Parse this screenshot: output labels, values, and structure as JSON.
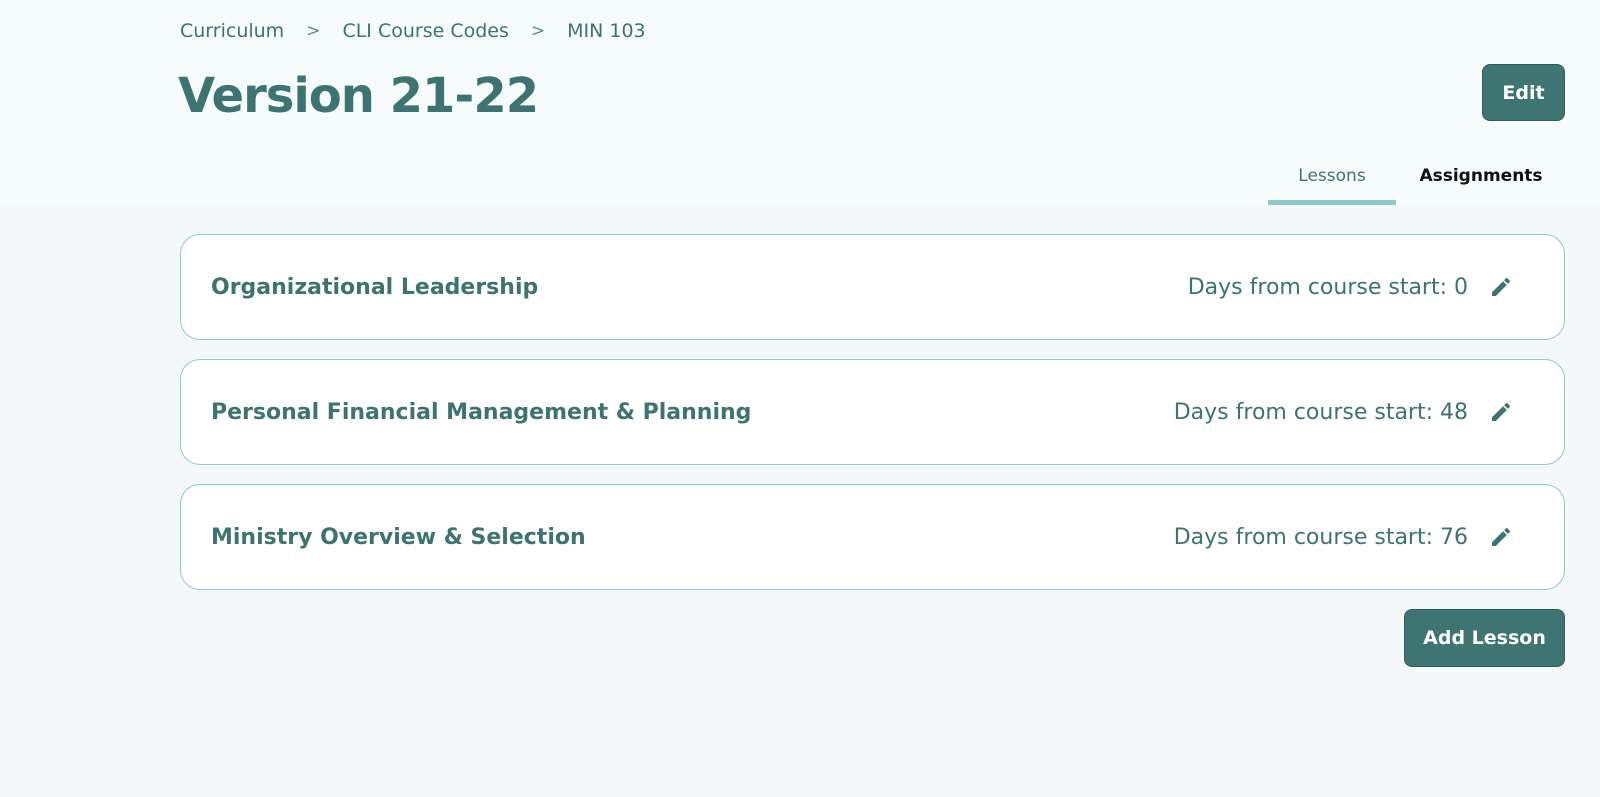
{
  "breadcrumb": {
    "items": [
      "Curriculum",
      "CLI Course Codes",
      "MIN 103"
    ],
    "separator": ">"
  },
  "page": {
    "title": "Version 21-22"
  },
  "header": {
    "edit_label": "Edit"
  },
  "tabs": [
    {
      "label": "Lessons",
      "active": true
    },
    {
      "label": "Assignments",
      "active": false
    }
  ],
  "lessons": [
    {
      "title": "Organizational Leadership",
      "days": "Days from course start: 0",
      "action_icon": "pencil-icon"
    },
    {
      "title": "Personal Financial Management & Planning",
      "days": "Days from course start: 48",
      "action_icon": "pencil-icon"
    },
    {
      "title": "Ministry Overview & Selection",
      "days": "Days from course start: 76",
      "action_icon": "pencil-icon"
    }
  ],
  "footer": {
    "add_lesson_label": "Add Lesson"
  },
  "colors": {
    "primary": "#3e7471",
    "accent_border": "#8ccbc9",
    "tab_underline": "#8ec9c8",
    "header_bg": "#f6fbfc",
    "page_bg": "#f5f8f8"
  }
}
